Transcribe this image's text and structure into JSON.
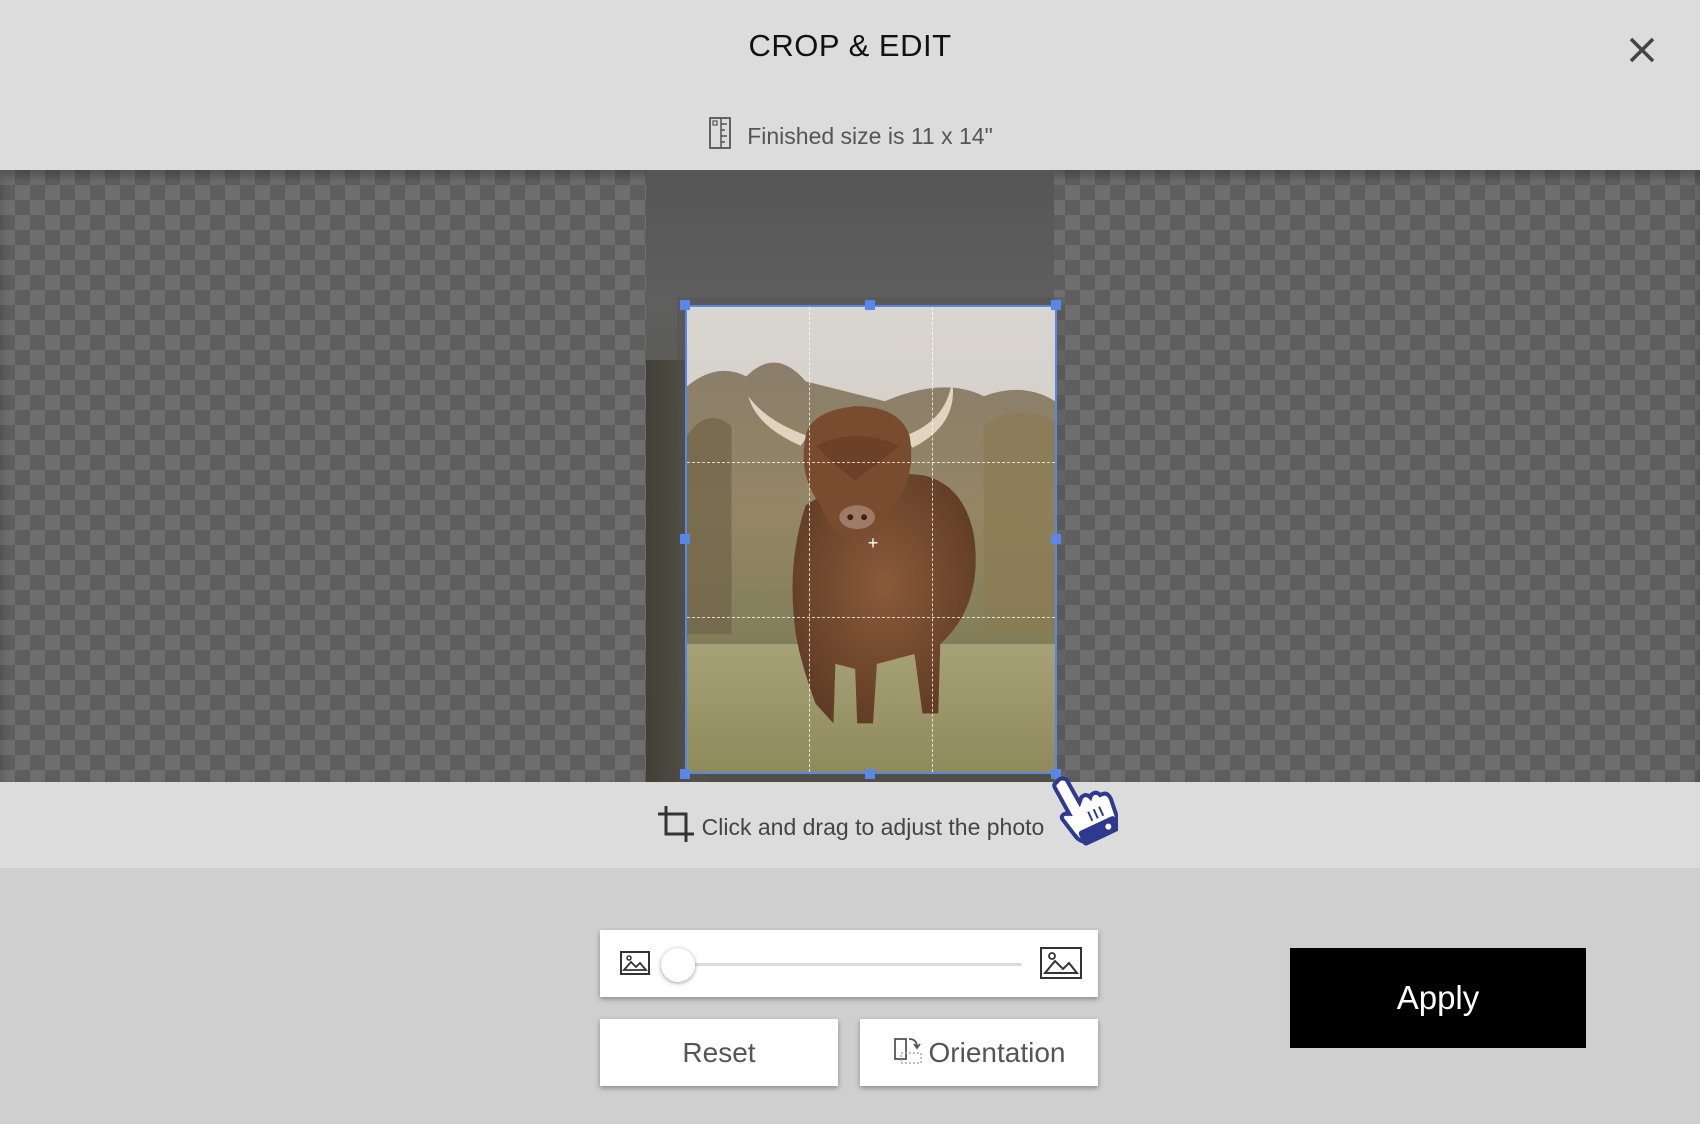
{
  "header": {
    "title": "CROP & EDIT",
    "finished_size": "Finished size is 11 x 14\""
  },
  "editor": {
    "hint": "Click and drag to adjust the photo"
  },
  "zoom": {
    "level": 0.0
  },
  "buttons": {
    "reset": "Reset",
    "orientation": "Orientation",
    "apply": "Apply"
  },
  "colors": {
    "accent": "#5b86e5",
    "apply_bg": "#000000"
  }
}
